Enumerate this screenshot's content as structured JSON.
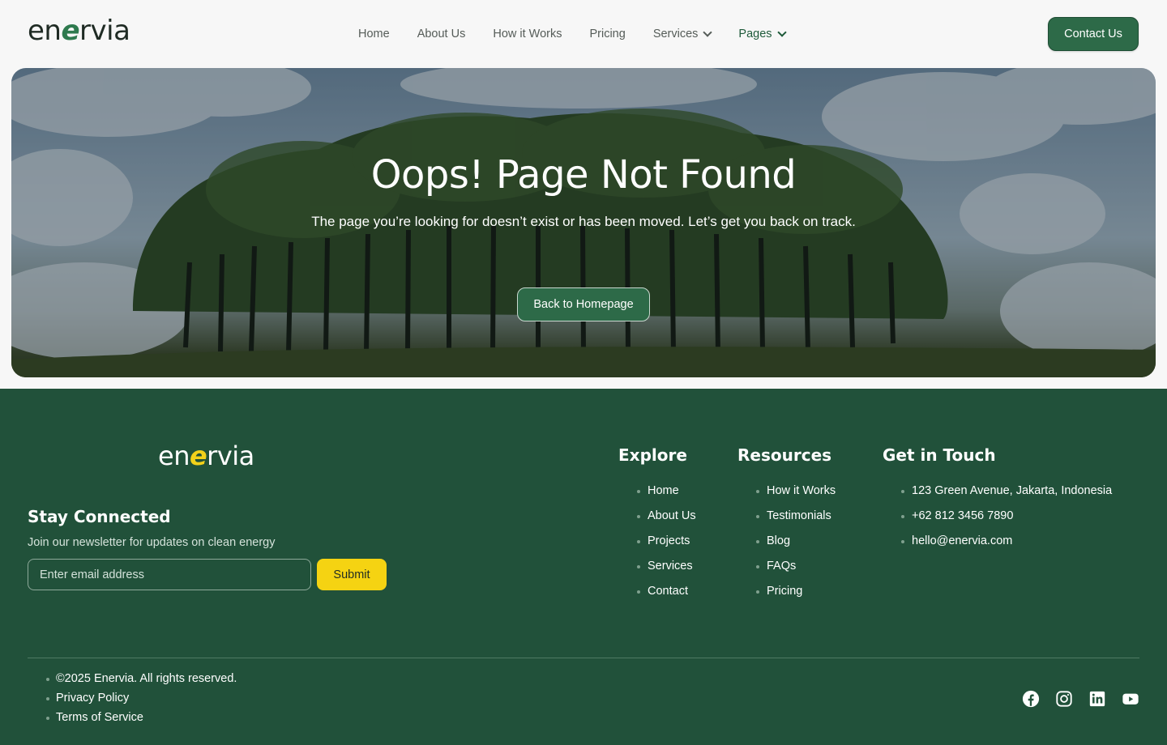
{
  "header": {
    "logo": {
      "pre": "en",
      "leaf": "e",
      "post": "rvia"
    },
    "nav": [
      {
        "label": "Home"
      },
      {
        "label": "About Us"
      },
      {
        "label": "How it Works"
      },
      {
        "label": "Pricing"
      },
      {
        "label": "Services"
      },
      {
        "label": "Pages"
      }
    ],
    "contact_label": "Contact Us"
  },
  "hero": {
    "title": "Oops! Page Not Found",
    "subtitle": "The page you’re looking for doesn’t exist or has been moved. Let’s get you back on track.",
    "button_label": "Back to Homepage"
  },
  "footer": {
    "logo": {
      "pre": "en",
      "leaf": "e",
      "post": "rvia"
    },
    "newsletter": {
      "title": "Stay Connected",
      "subtitle": "Join our newsletter for updates on clean energy",
      "placeholder": "Enter email address",
      "submit_label": "Submit"
    },
    "explore": {
      "title": "Explore",
      "items": [
        "Home",
        "About Us",
        "Projects",
        "Services",
        "Contact"
      ]
    },
    "resources": {
      "title": "Resources",
      "items": [
        "How it Works",
        "Testimonials",
        "Blog",
        "FAQs",
        "Pricing"
      ]
    },
    "contact": {
      "title": "Get in Touch",
      "items": [
        "123 Green Avenue, Jakarta, Indonesia",
        "+62 812 3456 7890",
        "hello@enervia.com"
      ]
    },
    "legal": [
      "©2025 Enervia. All rights reserved.",
      "Privacy Policy",
      "Terms of Service"
    ],
    "socials": [
      "facebook-icon",
      "instagram-icon",
      "linkedin-icon",
      "youtube-icon"
    ]
  },
  "colors": {
    "brand_green": "#2d6a48",
    "footer_bg": "#21513a",
    "accent_yellow": "#f5d312"
  }
}
